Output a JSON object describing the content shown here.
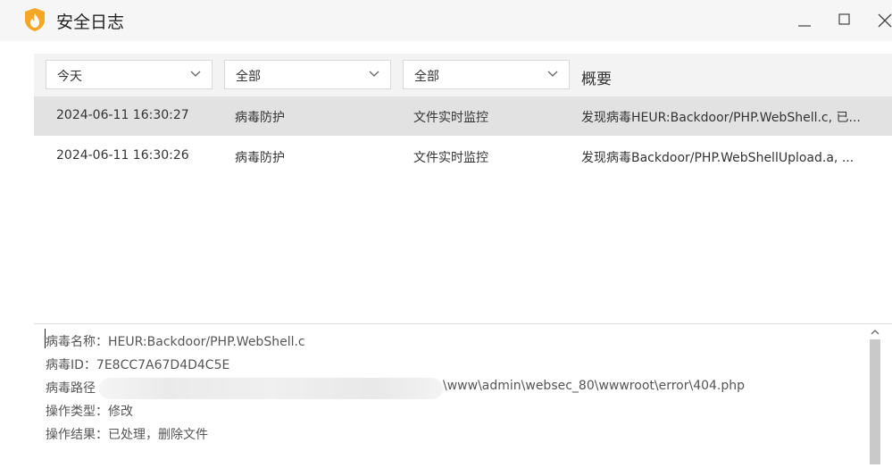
{
  "window": {
    "title": "安全日志",
    "icons": {
      "app": "shield-flame-icon",
      "minimize": "minimize-icon",
      "maximize": "maximize-icon",
      "close": "close-icon"
    },
    "colors": {
      "accent": "#f5a623",
      "selected_row": "#e2e2e2"
    }
  },
  "filters": {
    "date": "今天",
    "category": "全部",
    "source": "全部",
    "summary_header": "概要"
  },
  "log_rows": [
    {
      "time": "2024-06-11 16:30:27",
      "category": "病毒防护",
      "source": "文件实时监控",
      "summary": "发现病毒HEUR:Backdoor/PHP.WebShell.c, 已..."
    },
    {
      "time": "2024-06-11 16:30:26",
      "category": "病毒防护",
      "source": "文件实时监控",
      "summary": "发现病毒Backdoor/PHP.WebShellUpload.a, ..."
    }
  ],
  "details": {
    "virus_name_label": "病毒名称：",
    "virus_name": "HEUR:Backdoor/PHP.WebShell.c",
    "virus_id_label": "病毒ID：",
    "virus_id": "7E8CC7A67D4D4C5E",
    "virus_path_label": "病毒路径",
    "virus_path_visible": "\\www\\admin\\websec_80\\wwwroot\\error\\404.php",
    "op_type_label": "操作类型：",
    "op_type": "修改",
    "op_result_label": "操作结果：",
    "op_result": "已处理，删除文件"
  }
}
